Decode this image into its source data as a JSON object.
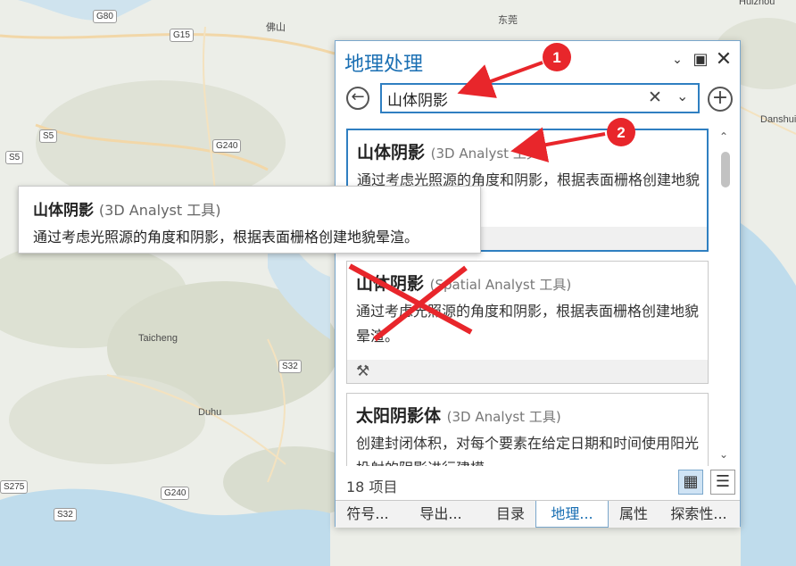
{
  "map": {
    "labels": [
      "Huizhou",
      "东莞",
      "佛山",
      "Danshui",
      "Taicheng",
      "Duhu"
    ],
    "shields": [
      "G80",
      "G15",
      "G240",
      "S5",
      "S5",
      "S32",
      "G240",
      "S275",
      "S32"
    ]
  },
  "tooltip": {
    "title": "山体阴影",
    "subtitle": "(3D Analyst 工具)",
    "description": "通过考虑光照源的角度和阴影，根据表面栅格创建地貌晕渲。"
  },
  "pane": {
    "title": "地理处理",
    "window_icons": [
      "chevron-down-icon",
      "maximize-icon",
      "close-icon"
    ],
    "search": {
      "value": "山体阴影",
      "placeholder": ""
    },
    "results": [
      {
        "title": "山体阴影",
        "subtitle": "(3D Analyst 工具)",
        "description": "通过考虑光照源的角度和阴影，根据表面栅格创建地貌晕渲。",
        "selected": true
      },
      {
        "title": "山体阴影",
        "subtitle": "(Spatial Analyst 工具)",
        "description": "通过考虑光照源的角度和阴影，根据表面栅格创建地貌晕渲。",
        "selected": false
      },
      {
        "title": "太阳阴影体",
        "subtitle": "(3D Analyst 工具)",
        "description": "创建封闭体积，对每个要素在给定日期和时间使用阳光投射的阴影进行建模。",
        "selected": false
      }
    ],
    "count_label": "18 项目",
    "tabs": [
      "符号...",
      "导出...",
      "目录",
      "地理...",
      "属性",
      "探索性..."
    ],
    "active_tab": "地理..."
  },
  "annotations": {
    "badges": [
      "1",
      "2"
    ],
    "accent_color": "#e8262b"
  }
}
